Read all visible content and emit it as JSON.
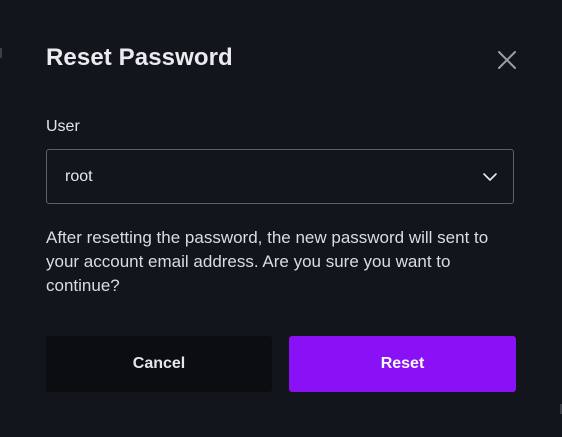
{
  "dialog": {
    "title": "Reset Password",
    "close_icon": "close-icon"
  },
  "form": {
    "user_label": "User",
    "user_value": "root",
    "dropdown_icon": "chevron-down-icon"
  },
  "message": "After resetting the password, the new password will sent to your account email address. Are you sure you want to continue?",
  "buttons": {
    "cancel_label": "Cancel",
    "reset_label": "Reset"
  },
  "colors": {
    "background": "#12161c",
    "primary": "#8a10f6",
    "cancel_bg": "#0b0d11",
    "border": "#5a616b"
  }
}
